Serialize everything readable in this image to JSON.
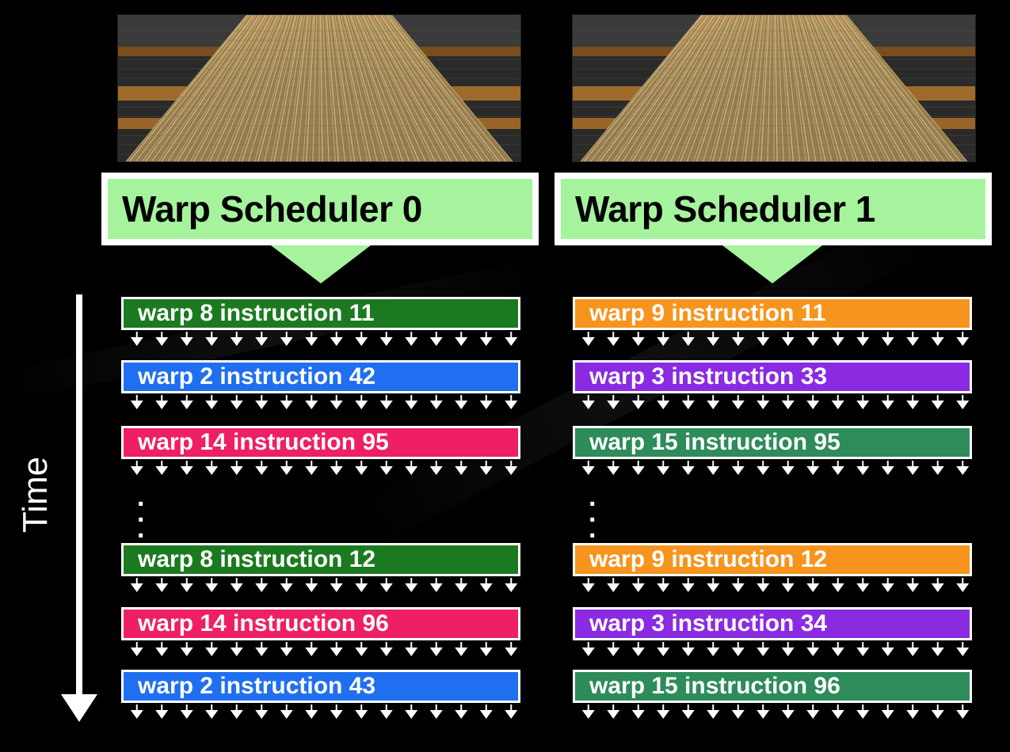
{
  "time_label": "Time",
  "schedulers": [
    {
      "title": "Warp Scheduler 0",
      "instructions": [
        {
          "label": "warp 8 instruction 11",
          "color": "#1b7a1f"
        },
        {
          "label": "warp 2 instruction 42",
          "color": "#1f6ff0"
        },
        {
          "label": "warp 14 instruction 95",
          "color": "#ee1f63"
        },
        {
          "label": "warp 8 instruction 12",
          "color": "#1b7a1f"
        },
        {
          "label": "warp 14 instruction 96",
          "color": "#ee1f63"
        },
        {
          "label": "warp 2 instruction 43",
          "color": "#1f6ff0"
        }
      ]
    },
    {
      "title": "Warp Scheduler 1",
      "instructions": [
        {
          "label": "warp 9 instruction 11",
          "color": "#f7941d"
        },
        {
          "label": "warp 3 instruction 33",
          "color": "#8a2be2"
        },
        {
          "label": "warp 15 instruction 95",
          "color": "#2e8b5a"
        },
        {
          "label": "warp 9 instruction 12",
          "color": "#f7941d"
        },
        {
          "label": "warp 3 instruction 34",
          "color": "#8a2be2"
        },
        {
          "label": "warp 15 instruction 96",
          "color": "#2e8b5a"
        }
      ]
    }
  ],
  "colors": {
    "scheduler_fill": "#a6f39e",
    "background": "#000000",
    "thread_arrow": "#ffffff"
  }
}
